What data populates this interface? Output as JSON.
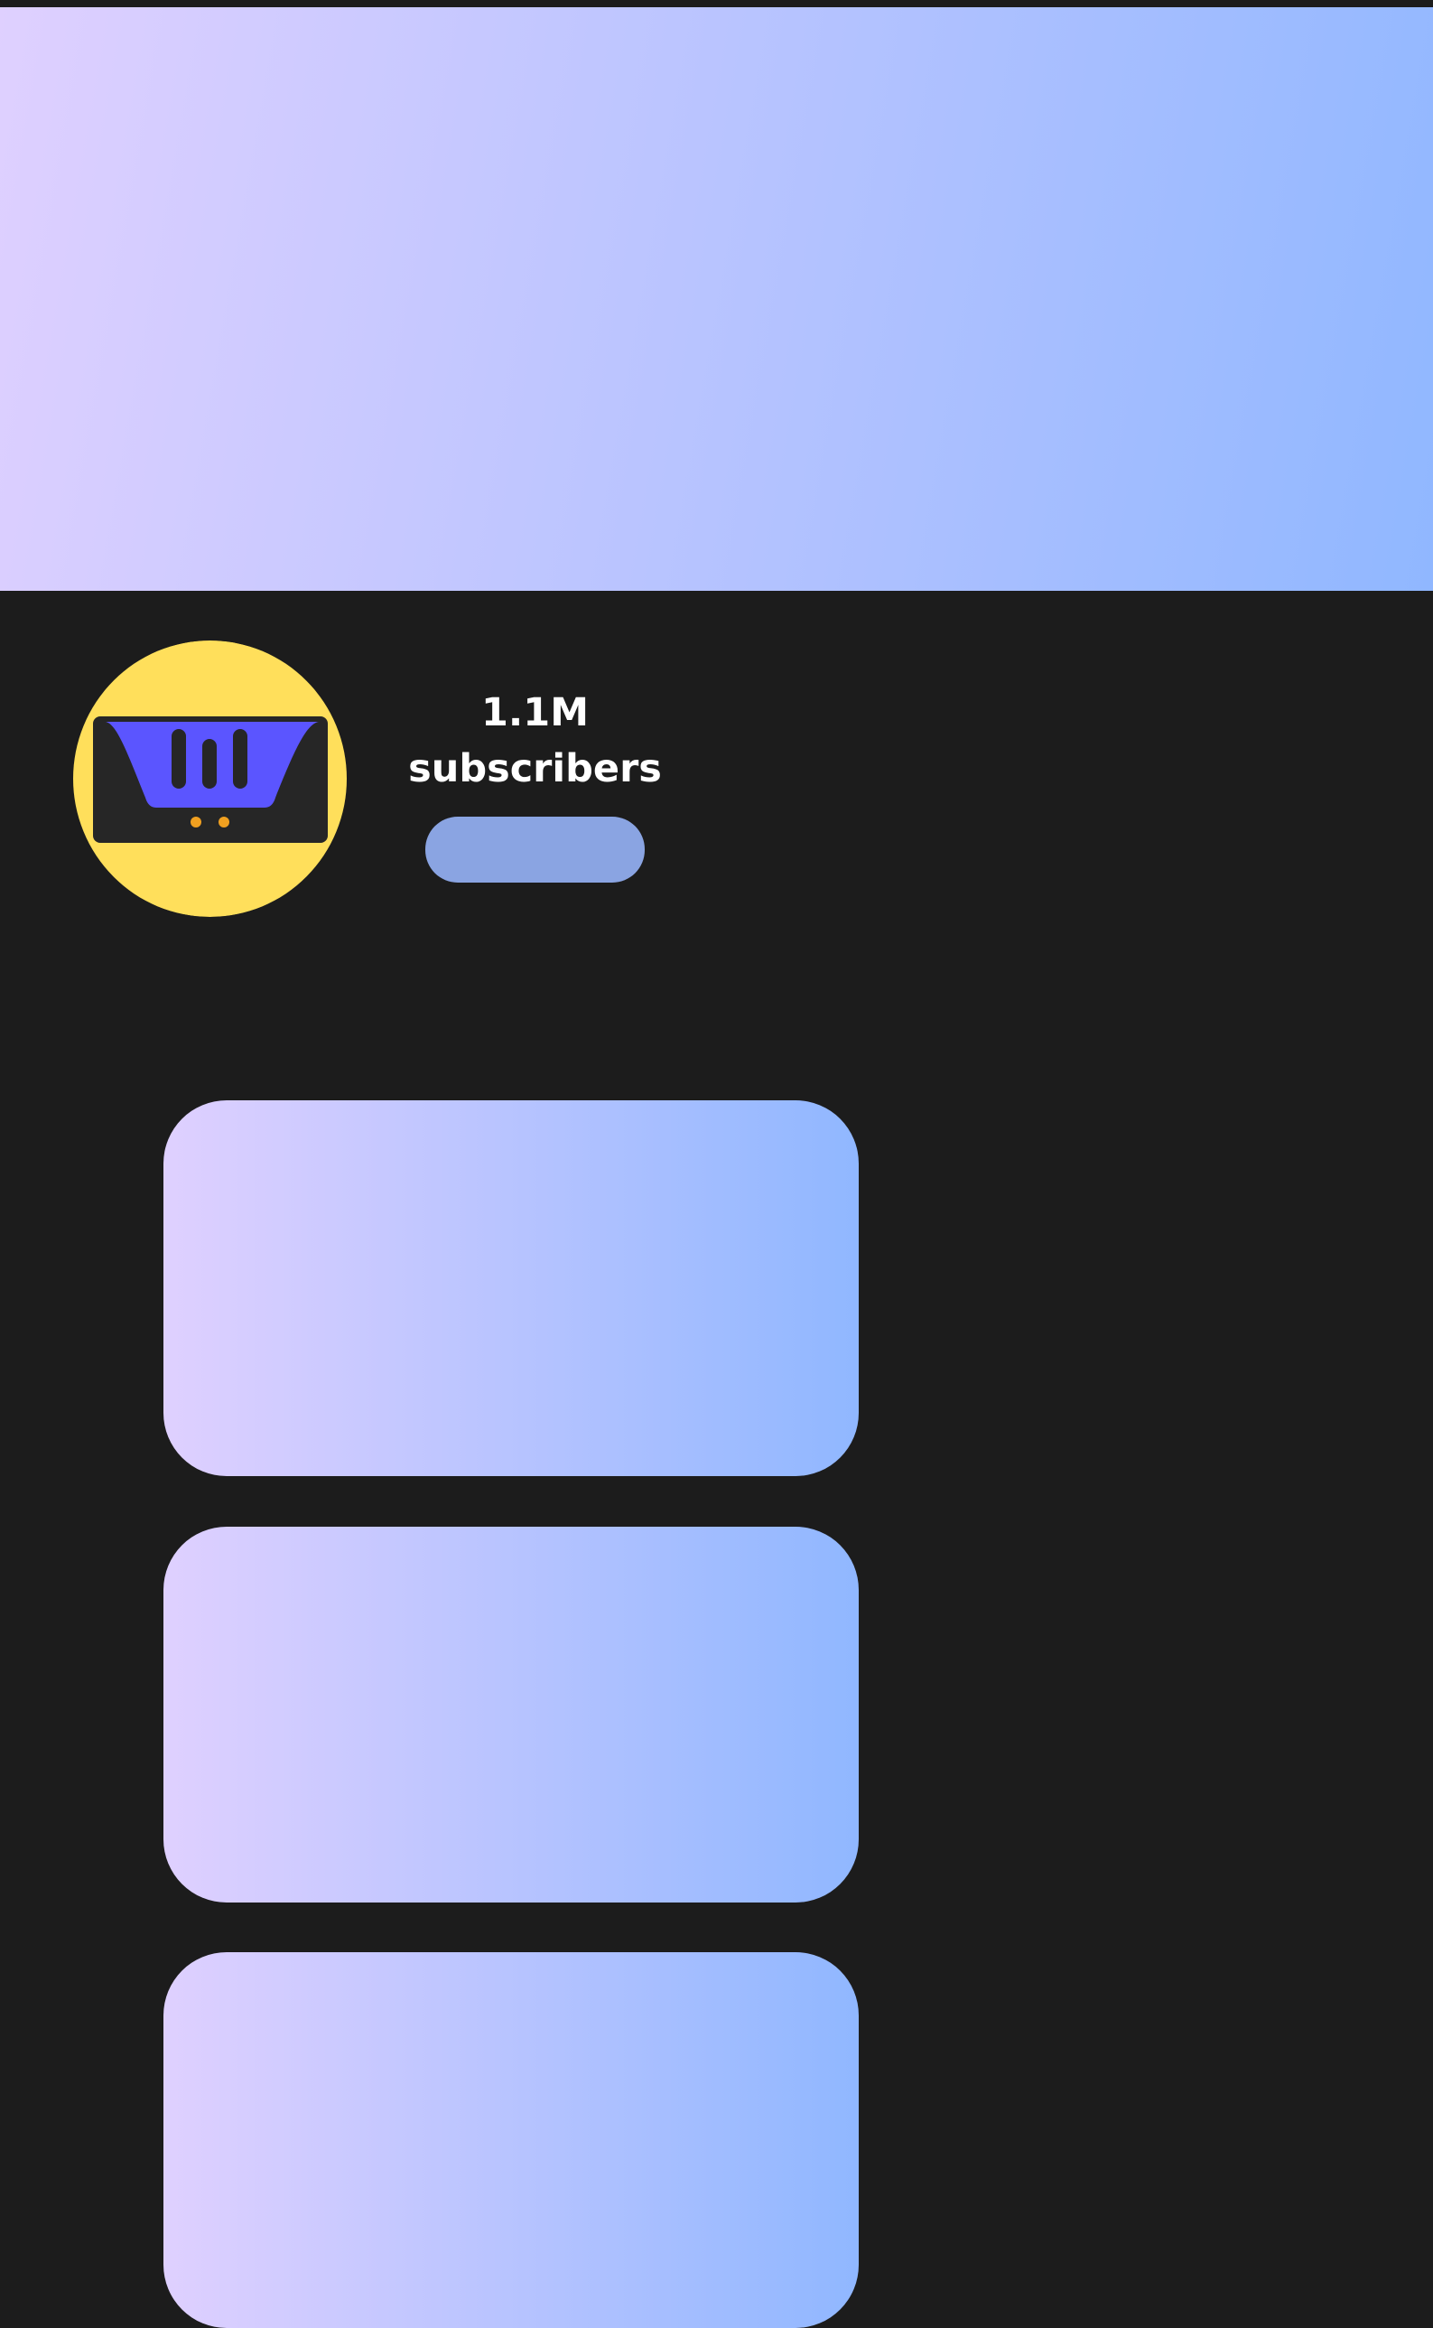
{
  "colors": {
    "page_background": "#1c1c1c",
    "gradient_start": "#dfd0ff",
    "gradient_end": "#90b7ff",
    "subscribe_button": "#8aa4e2",
    "avatar_background": "#ffdf5b",
    "avatar_screen": "#5b55ff",
    "avatar_frame": "#262626",
    "avatar_lights": "#f0a020",
    "text": "#ffffff"
  },
  "channel": {
    "subscriber_count": "1.1M",
    "subscriber_label": "subscribers",
    "subscribe_button_label": ""
  },
  "icons": {
    "avatar": "tv-screen-logo-icon"
  },
  "videos": [
    {
      "title": ""
    },
    {
      "title": ""
    },
    {
      "title": ""
    }
  ]
}
